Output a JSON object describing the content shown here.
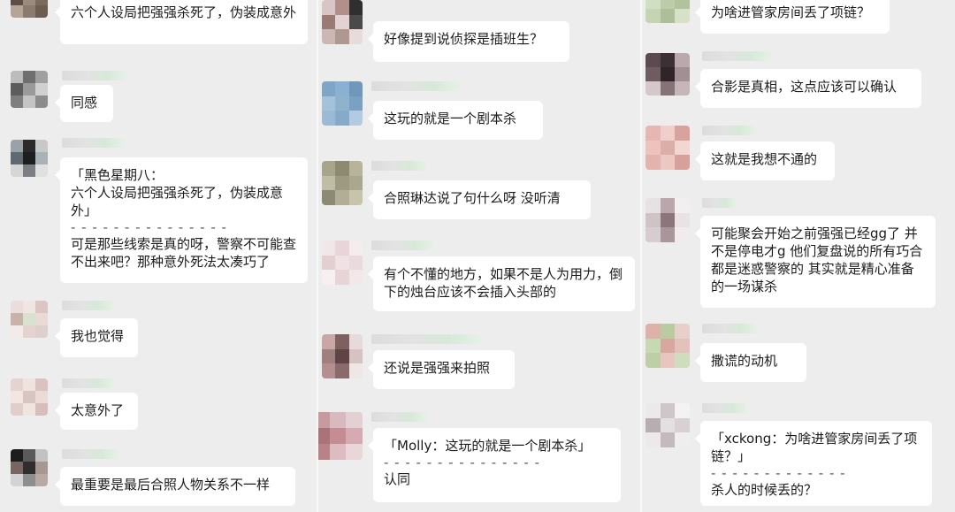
{
  "col1": {
    "messages": [
      {
        "text": "六个人设局把强强杀死了，伪装成意外"
      },
      {
        "text": "同感"
      },
      {
        "quote_header": "「黑色星期八：",
        "quote_body": "六个人设局把强强杀死了，伪装成意外」",
        "divider": "- - - - - - - - - - - - - - -",
        "text": "可是那些线索是真的呀，警察不可能查不出来吧？那种意外死法太凑巧了"
      },
      {
        "text": "我也觉得"
      },
      {
        "text": "太意外了"
      },
      {
        "text": "最重要是最后合照人物关系不一样"
      }
    ]
  },
  "col2": {
    "messages": [
      {
        "text": "好像提到说侦探是插班生？"
      },
      {
        "text": "这玩的就是一个剧本杀"
      },
      {
        "text": "合照琳达说了句什么呀 没听清"
      },
      {
        "text": "有个不懂的地方，如果不是人为用力，倒下的烛台应该不会插入头部的"
      },
      {
        "text": "还说是强强来拍照"
      },
      {
        "quote": "「Molly：这玩的就是一个剧本杀」",
        "divider": "- - - - - - - - - - - - - - -",
        "text": "认同"
      }
    ]
  },
  "col3": {
    "messages": [
      {
        "text": "为啥进管家房间丢了项链？"
      },
      {
        "text": "合影是真相，这点应该可以确认"
      },
      {
        "text": "这就是我想不通的"
      },
      {
        "text": "可能聚会开始之前强强已经gg了 并不是停电才g  他们复盘说的所有巧合都是迷惑警察的  其实就是精心准备的一场谋杀"
      },
      {
        "text": "撒谎的动机"
      },
      {
        "quote": "「xckong：为啥进管家房间丢了项链？」",
        "divider": "- - - - - - - - - - - - -",
        "text": "杀人的时候丢的？"
      }
    ]
  },
  "avatar_colors": {
    "a1": [
      "#8b7a6a",
      "#6d5f55",
      "#a69283",
      "#5a4e47",
      "#9c8b7c",
      "#7a6a5d",
      "#b5a596",
      "#8a7b6e",
      "#6b5d52"
    ],
    "a2": [
      "#bcbcbc",
      "#6f6f6f",
      "#a0a0a0",
      "#5c5c5c",
      "#9a9a9a",
      "#d0d0d0",
      "#7e7e7e",
      "#c4c4c4",
      "#8c8c8c"
    ],
    "a3": [
      "#9aa2a8",
      "#2a2a2a",
      "#c8c8c8",
      "#5d6a72",
      "#1e1e1e",
      "#a9b2b7",
      "#d6d6d6",
      "#7b7f84",
      "#e0e0e0"
    ],
    "a4": [
      "#e9dedd",
      "#f1e5e4",
      "#dcc6c4",
      "#c8b3a8",
      "#d9e2cf",
      "#eadad6",
      "#f3ebe9",
      "#e4d3cf",
      "#ddd0cc"
    ],
    "a5": [
      "#e6d2cf",
      "#efe3e0",
      "#dac3bf",
      "#f2e6e3",
      "#d8c4c0",
      "#eadbd8",
      "#e1cdc9",
      "#f0e4e1",
      "#d6bfba"
    ],
    "a6": [
      "#1d1d1d",
      "#5a5a5a",
      "#c2c2c2",
      "#7a6660",
      "#2e2e2e",
      "#a89790",
      "#d3d3d3",
      "#8e8e8e",
      "#b7aaa5"
    ],
    "b1": [
      "#d8c6c6",
      "#b28f8a",
      "#2f2f2f",
      "#9b7a73",
      "#e3d2d2",
      "#4a4a4a",
      "#cbb8b4",
      "#b09892",
      "#e7dcda"
    ],
    "b2": [
      "#7fa6c7",
      "#8ab1d1",
      "#6f98bb",
      "#a4c2da",
      "#8fb2cd",
      "#7aa1c4",
      "#9cbad3",
      "#86abc9",
      "#b2cbe0"
    ],
    "b3": [
      "#a7a58a",
      "#8c8a70",
      "#b8b39b",
      "#c0bda6",
      "#9d9a80",
      "#aaa78f",
      "#8d8a74",
      "#b2ae96",
      "#c7c4ae"
    ],
    "b4": [
      "#f1e6e8",
      "#e8d5d9",
      "#f5eced",
      "#e3cfd2",
      "#f0e2e4",
      "#ebdadd",
      "#f7f0f1",
      "#e6d4d7",
      "#f2e7e9"
    ],
    "b5": [
      "#caa7a7",
      "#7f5f5f",
      "#e6dada",
      "#a07f7f",
      "#5e4545",
      "#d7c2c2",
      "#b38f8f",
      "#8a6a6a",
      "#efe6e6"
    ],
    "b6": [
      "#c79aa0",
      "#d8b9bd",
      "#e4cfd2",
      "#a97379",
      "#c58c93",
      "#d5abb1",
      "#b98288",
      "#dcbcc0",
      "#e8d6d8"
    ],
    "d1": [
      "#b7c8a4",
      "#c9d7b8",
      "#a8bb93",
      "#d2dec3",
      "#bccca9",
      "#b1c39d",
      "#c5d4b3",
      "#adbf98",
      "#d6e1c8"
    ],
    "d2": [
      "#5b4a4f",
      "#3d2f33",
      "#b9a9ad",
      "#6e5c61",
      "#2f2427",
      "#a18f94",
      "#d5c8cb",
      "#857378",
      "#c4b6b9"
    ],
    "d3": [
      "#e6b7b2",
      "#f0cfcb",
      "#d9a39d",
      "#eec2bd",
      "#dcaea8",
      "#f2d6d2",
      "#e3b4ae",
      "#ecc8c3",
      "#d7a09a"
    ],
    "d4": [
      "#e6e1e3",
      "#b9a7ab",
      "#f2eff0",
      "#cfc3c6",
      "#8b777b",
      "#e9e3e5",
      "#d7cdd0",
      "#a8969a",
      "#f0ecee"
    ],
    "d5": [
      "#dcb2aa",
      "#b8cca0",
      "#e8d0ca",
      "#c7d9b3",
      "#d6a89f",
      "#e2c2bb",
      "#bccfa6",
      "#e8c6bf",
      "#cfdcbe"
    ],
    "d6": [
      "#ece9ea",
      "#cfc6c8",
      "#f4f2f2",
      "#b8adb0",
      "#e4dfe0",
      "#d8d1d3",
      "#ede9ea",
      "#c4babd",
      "#f0eded"
    ]
  }
}
